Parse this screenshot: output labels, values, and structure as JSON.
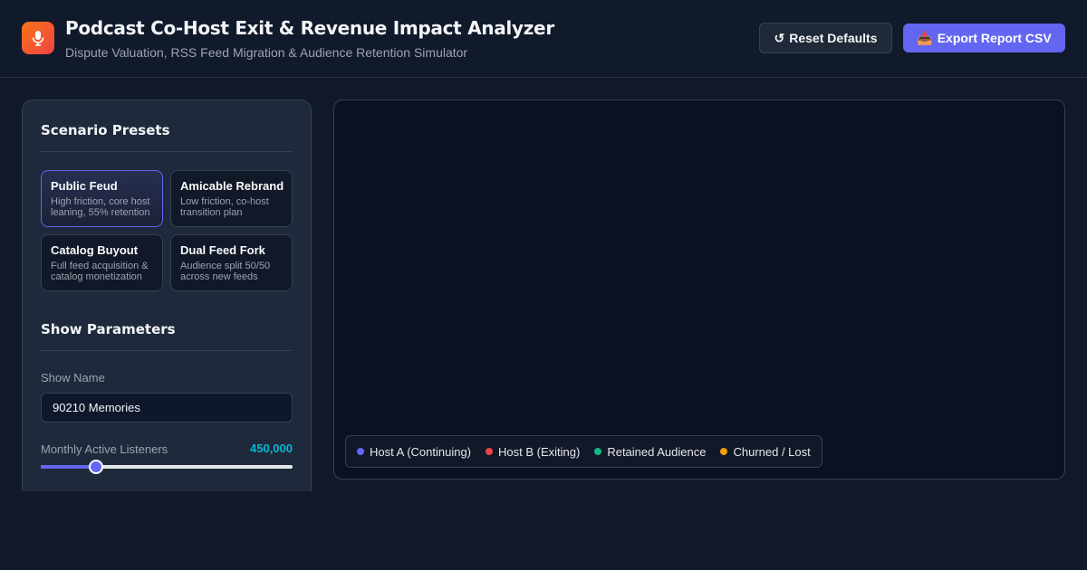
{
  "header": {
    "title": "Podcast Co-Host Exit & Revenue Impact Analyzer",
    "subtitle": "Dispute Valuation, RSS Feed Migration & Audience Retention Simulator",
    "app_icon": "microphone-icon",
    "reset_label": "Reset Defaults",
    "reset_icon": "↺",
    "export_label": "Export Report CSV",
    "export_icon": "📥"
  },
  "sidebar": {
    "presets_title": "Scenario Presets",
    "presets": [
      {
        "title": "Public Feud",
        "desc": "High friction, core host leaning, 55% retention",
        "active": true
      },
      {
        "title": "Amicable Rebrand",
        "desc": "Low friction, co-host transition plan",
        "active": false
      },
      {
        "title": "Catalog Buyout",
        "desc": "Full feed acquisition & catalog monetization",
        "active": false
      },
      {
        "title": "Dual Feed Fork",
        "desc": "Audience split 50/50 across new feeds",
        "active": false
      }
    ],
    "params_title": "Show Parameters",
    "show_name_label": "Show Name",
    "show_name_value": "90210 Memories",
    "listeners_label": "Monthly Active Listeners",
    "listeners_value": "450,000",
    "listeners_fraction": 0.22
  },
  "chart": {
    "legend": [
      {
        "label": "Host A (Continuing)",
        "color": "#6366f1"
      },
      {
        "label": "Host B (Exiting)",
        "color": "#ef4444"
      },
      {
        "label": "Retained Audience",
        "color": "#10b981"
      },
      {
        "label": "Churned / Lost",
        "color": "#f59e0b"
      }
    ]
  },
  "colors": {
    "accent": "#6366f1",
    "value": "#06b6d4"
  }
}
